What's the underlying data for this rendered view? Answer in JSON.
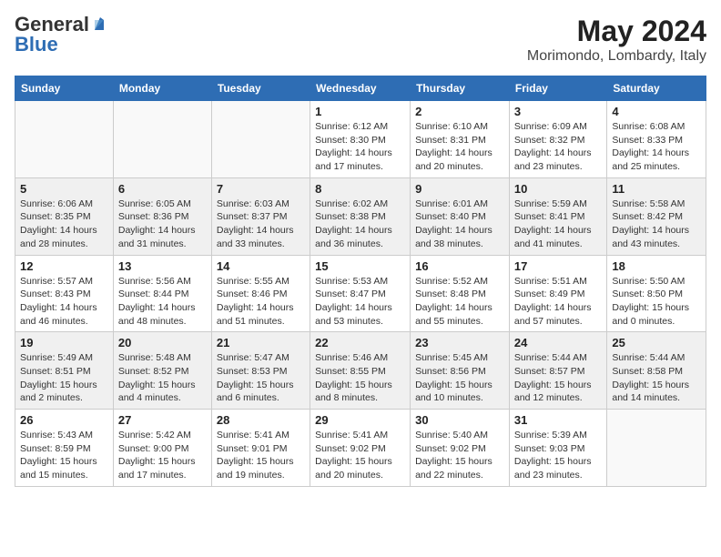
{
  "header": {
    "logo_general": "General",
    "logo_blue": "Blue",
    "title": "May 2024",
    "location": "Morimondo, Lombardy, Italy"
  },
  "weekdays": [
    "Sunday",
    "Monday",
    "Tuesday",
    "Wednesday",
    "Thursday",
    "Friday",
    "Saturday"
  ],
  "rows": [
    [
      {
        "day": "",
        "info": ""
      },
      {
        "day": "",
        "info": ""
      },
      {
        "day": "",
        "info": ""
      },
      {
        "day": "1",
        "info": "Sunrise: 6:12 AM\nSunset: 8:30 PM\nDaylight: 14 hours\nand 17 minutes."
      },
      {
        "day": "2",
        "info": "Sunrise: 6:10 AM\nSunset: 8:31 PM\nDaylight: 14 hours\nand 20 minutes."
      },
      {
        "day": "3",
        "info": "Sunrise: 6:09 AM\nSunset: 8:32 PM\nDaylight: 14 hours\nand 23 minutes."
      },
      {
        "day": "4",
        "info": "Sunrise: 6:08 AM\nSunset: 8:33 PM\nDaylight: 14 hours\nand 25 minutes."
      }
    ],
    [
      {
        "day": "5",
        "info": "Sunrise: 6:06 AM\nSunset: 8:35 PM\nDaylight: 14 hours\nand 28 minutes."
      },
      {
        "day": "6",
        "info": "Sunrise: 6:05 AM\nSunset: 8:36 PM\nDaylight: 14 hours\nand 31 minutes."
      },
      {
        "day": "7",
        "info": "Sunrise: 6:03 AM\nSunset: 8:37 PM\nDaylight: 14 hours\nand 33 minutes."
      },
      {
        "day": "8",
        "info": "Sunrise: 6:02 AM\nSunset: 8:38 PM\nDaylight: 14 hours\nand 36 minutes."
      },
      {
        "day": "9",
        "info": "Sunrise: 6:01 AM\nSunset: 8:40 PM\nDaylight: 14 hours\nand 38 minutes."
      },
      {
        "day": "10",
        "info": "Sunrise: 5:59 AM\nSunset: 8:41 PM\nDaylight: 14 hours\nand 41 minutes."
      },
      {
        "day": "11",
        "info": "Sunrise: 5:58 AM\nSunset: 8:42 PM\nDaylight: 14 hours\nand 43 minutes."
      }
    ],
    [
      {
        "day": "12",
        "info": "Sunrise: 5:57 AM\nSunset: 8:43 PM\nDaylight: 14 hours\nand 46 minutes."
      },
      {
        "day": "13",
        "info": "Sunrise: 5:56 AM\nSunset: 8:44 PM\nDaylight: 14 hours\nand 48 minutes."
      },
      {
        "day": "14",
        "info": "Sunrise: 5:55 AM\nSunset: 8:46 PM\nDaylight: 14 hours\nand 51 minutes."
      },
      {
        "day": "15",
        "info": "Sunrise: 5:53 AM\nSunset: 8:47 PM\nDaylight: 14 hours\nand 53 minutes."
      },
      {
        "day": "16",
        "info": "Sunrise: 5:52 AM\nSunset: 8:48 PM\nDaylight: 14 hours\nand 55 minutes."
      },
      {
        "day": "17",
        "info": "Sunrise: 5:51 AM\nSunset: 8:49 PM\nDaylight: 14 hours\nand 57 minutes."
      },
      {
        "day": "18",
        "info": "Sunrise: 5:50 AM\nSunset: 8:50 PM\nDaylight: 15 hours\nand 0 minutes."
      }
    ],
    [
      {
        "day": "19",
        "info": "Sunrise: 5:49 AM\nSunset: 8:51 PM\nDaylight: 15 hours\nand 2 minutes."
      },
      {
        "day": "20",
        "info": "Sunrise: 5:48 AM\nSunset: 8:52 PM\nDaylight: 15 hours\nand 4 minutes."
      },
      {
        "day": "21",
        "info": "Sunrise: 5:47 AM\nSunset: 8:53 PM\nDaylight: 15 hours\nand 6 minutes."
      },
      {
        "day": "22",
        "info": "Sunrise: 5:46 AM\nSunset: 8:55 PM\nDaylight: 15 hours\nand 8 minutes."
      },
      {
        "day": "23",
        "info": "Sunrise: 5:45 AM\nSunset: 8:56 PM\nDaylight: 15 hours\nand 10 minutes."
      },
      {
        "day": "24",
        "info": "Sunrise: 5:44 AM\nSunset: 8:57 PM\nDaylight: 15 hours\nand 12 minutes."
      },
      {
        "day": "25",
        "info": "Sunrise: 5:44 AM\nSunset: 8:58 PM\nDaylight: 15 hours\nand 14 minutes."
      }
    ],
    [
      {
        "day": "26",
        "info": "Sunrise: 5:43 AM\nSunset: 8:59 PM\nDaylight: 15 hours\nand 15 minutes."
      },
      {
        "day": "27",
        "info": "Sunrise: 5:42 AM\nSunset: 9:00 PM\nDaylight: 15 hours\nand 17 minutes."
      },
      {
        "day": "28",
        "info": "Sunrise: 5:41 AM\nSunset: 9:01 PM\nDaylight: 15 hours\nand 19 minutes."
      },
      {
        "day": "29",
        "info": "Sunrise: 5:41 AM\nSunset: 9:02 PM\nDaylight: 15 hours\nand 20 minutes."
      },
      {
        "day": "30",
        "info": "Sunrise: 5:40 AM\nSunset: 9:02 PM\nDaylight: 15 hours\nand 22 minutes."
      },
      {
        "day": "31",
        "info": "Sunrise: 5:39 AM\nSunset: 9:03 PM\nDaylight: 15 hours\nand 23 minutes."
      },
      {
        "day": "",
        "info": ""
      }
    ]
  ]
}
